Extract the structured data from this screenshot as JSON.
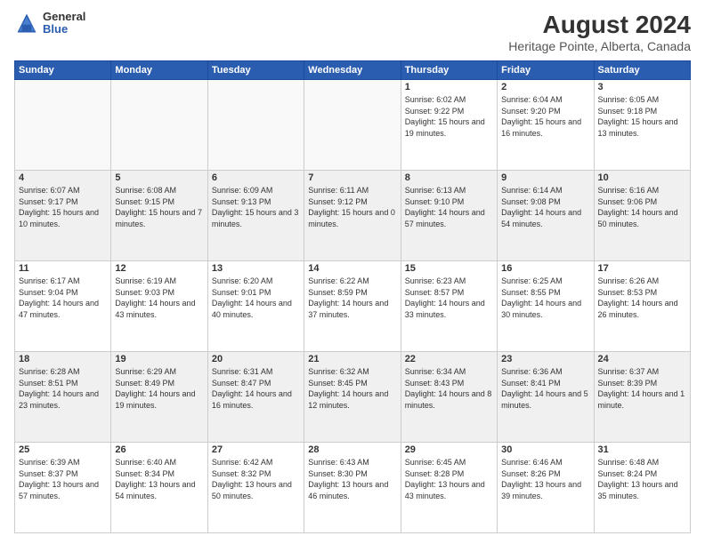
{
  "header": {
    "logo_general": "General",
    "logo_blue": "Blue",
    "title": "August 2024",
    "subtitle": "Heritage Pointe, Alberta, Canada"
  },
  "weekdays": [
    "Sunday",
    "Monday",
    "Tuesday",
    "Wednesday",
    "Thursday",
    "Friday",
    "Saturday"
  ],
  "weeks": [
    [
      {
        "day": "",
        "empty": true
      },
      {
        "day": "",
        "empty": true
      },
      {
        "day": "",
        "empty": true
      },
      {
        "day": "",
        "empty": true
      },
      {
        "day": "1",
        "sunrise": "6:02 AM",
        "sunset": "9:22 PM",
        "daylight": "15 hours and 19 minutes."
      },
      {
        "day": "2",
        "sunrise": "6:04 AM",
        "sunset": "9:20 PM",
        "daylight": "15 hours and 16 minutes."
      },
      {
        "day": "3",
        "sunrise": "6:05 AM",
        "sunset": "9:18 PM",
        "daylight": "15 hours and 13 minutes."
      }
    ],
    [
      {
        "day": "4",
        "sunrise": "6:07 AM",
        "sunset": "9:17 PM",
        "daylight": "15 hours and 10 minutes."
      },
      {
        "day": "5",
        "sunrise": "6:08 AM",
        "sunset": "9:15 PM",
        "daylight": "15 hours and 7 minutes."
      },
      {
        "day": "6",
        "sunrise": "6:09 AM",
        "sunset": "9:13 PM",
        "daylight": "15 hours and 3 minutes."
      },
      {
        "day": "7",
        "sunrise": "6:11 AM",
        "sunset": "9:12 PM",
        "daylight": "15 hours and 0 minutes."
      },
      {
        "day": "8",
        "sunrise": "6:13 AM",
        "sunset": "9:10 PM",
        "daylight": "14 hours and 57 minutes."
      },
      {
        "day": "9",
        "sunrise": "6:14 AM",
        "sunset": "9:08 PM",
        "daylight": "14 hours and 54 minutes."
      },
      {
        "day": "10",
        "sunrise": "6:16 AM",
        "sunset": "9:06 PM",
        "daylight": "14 hours and 50 minutes."
      }
    ],
    [
      {
        "day": "11",
        "sunrise": "6:17 AM",
        "sunset": "9:04 PM",
        "daylight": "14 hours and 47 minutes."
      },
      {
        "day": "12",
        "sunrise": "6:19 AM",
        "sunset": "9:03 PM",
        "daylight": "14 hours and 43 minutes."
      },
      {
        "day": "13",
        "sunrise": "6:20 AM",
        "sunset": "9:01 PM",
        "daylight": "14 hours and 40 minutes."
      },
      {
        "day": "14",
        "sunrise": "6:22 AM",
        "sunset": "8:59 PM",
        "daylight": "14 hours and 37 minutes."
      },
      {
        "day": "15",
        "sunrise": "6:23 AM",
        "sunset": "8:57 PM",
        "daylight": "14 hours and 33 minutes."
      },
      {
        "day": "16",
        "sunrise": "6:25 AM",
        "sunset": "8:55 PM",
        "daylight": "14 hours and 30 minutes."
      },
      {
        "day": "17",
        "sunrise": "6:26 AM",
        "sunset": "8:53 PM",
        "daylight": "14 hours and 26 minutes."
      }
    ],
    [
      {
        "day": "18",
        "sunrise": "6:28 AM",
        "sunset": "8:51 PM",
        "daylight": "14 hours and 23 minutes."
      },
      {
        "day": "19",
        "sunrise": "6:29 AM",
        "sunset": "8:49 PM",
        "daylight": "14 hours and 19 minutes."
      },
      {
        "day": "20",
        "sunrise": "6:31 AM",
        "sunset": "8:47 PM",
        "daylight": "14 hours and 16 minutes."
      },
      {
        "day": "21",
        "sunrise": "6:32 AM",
        "sunset": "8:45 PM",
        "daylight": "14 hours and 12 minutes."
      },
      {
        "day": "22",
        "sunrise": "6:34 AM",
        "sunset": "8:43 PM",
        "daylight": "14 hours and 8 minutes."
      },
      {
        "day": "23",
        "sunrise": "6:36 AM",
        "sunset": "8:41 PM",
        "daylight": "14 hours and 5 minutes."
      },
      {
        "day": "24",
        "sunrise": "6:37 AM",
        "sunset": "8:39 PM",
        "daylight": "14 hours and 1 minute."
      }
    ],
    [
      {
        "day": "25",
        "sunrise": "6:39 AM",
        "sunset": "8:37 PM",
        "daylight": "13 hours and 57 minutes."
      },
      {
        "day": "26",
        "sunrise": "6:40 AM",
        "sunset": "8:34 PM",
        "daylight": "13 hours and 54 minutes."
      },
      {
        "day": "27",
        "sunrise": "6:42 AM",
        "sunset": "8:32 PM",
        "daylight": "13 hours and 50 minutes."
      },
      {
        "day": "28",
        "sunrise": "6:43 AM",
        "sunset": "8:30 PM",
        "daylight": "13 hours and 46 minutes."
      },
      {
        "day": "29",
        "sunrise": "6:45 AM",
        "sunset": "8:28 PM",
        "daylight": "13 hours and 43 minutes."
      },
      {
        "day": "30",
        "sunrise": "6:46 AM",
        "sunset": "8:26 PM",
        "daylight": "13 hours and 39 minutes."
      },
      {
        "day": "31",
        "sunrise": "6:48 AM",
        "sunset": "8:24 PM",
        "daylight": "13 hours and 35 minutes."
      }
    ]
  ]
}
